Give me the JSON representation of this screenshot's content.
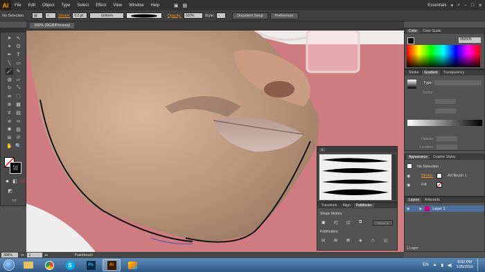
{
  "app": {
    "logo": "Ai",
    "workspace": "Essentials"
  },
  "menu": [
    "File",
    "Edit",
    "Object",
    "Type",
    "Select",
    "Effect",
    "View",
    "Window",
    "Help"
  ],
  "control": {
    "selection": "No Selection",
    "stroke_label": "Stroke:",
    "stroke_weight": "0.2 pt",
    "profile": "Uniform",
    "opacity_label": "Opacity:",
    "opacity": "100%",
    "style_label": "Style:",
    "doc_setup": "Document Setup",
    "preferences": "Preferences"
  },
  "document": {
    "tab": "300% (RGB/Preview)"
  },
  "status": {
    "zoom": "300%",
    "page": "1",
    "tool": "Paintbrush"
  },
  "panels": {
    "color": {
      "tabs": [
        "Color",
        "Color Guide"
      ],
      "hex": "050505"
    },
    "gradient": {
      "tabs": [
        "Stroke",
        "Gradient",
        "Transparency"
      ],
      "type_label": "Type:",
      "stroke_label": "Stroke:",
      "opacity_label": "Opacity:",
      "location_label": "Location:"
    },
    "brushes": {
      "tab": "Brushes"
    },
    "pathfinder": {
      "tabs": [
        "Transform",
        "Align",
        "Pathfinder"
      ],
      "shape_modes": "Shape Modes:",
      "pathfinders": "Pathfinders:",
      "expand": "Expand"
    },
    "appearance": {
      "tabs": [
        "Appearance",
        "Graphic Styles"
      ],
      "no_selection": "No Selection",
      "stroke_label": "Stroke:",
      "stroke_value": "Art Brush 1",
      "fill_label": "Fill:"
    },
    "layers": {
      "tabs": [
        "Layers",
        "Artboards"
      ],
      "layer_name": "Layer 1",
      "count": "1 Layer"
    }
  },
  "taskbar": {
    "lang": "EN",
    "time": "8:52 PM",
    "date": "1/25/2016"
  },
  "colors": {
    "accent": "#f29c1f",
    "skin": "#c9a58a",
    "bg_pink": "#d07f82"
  }
}
